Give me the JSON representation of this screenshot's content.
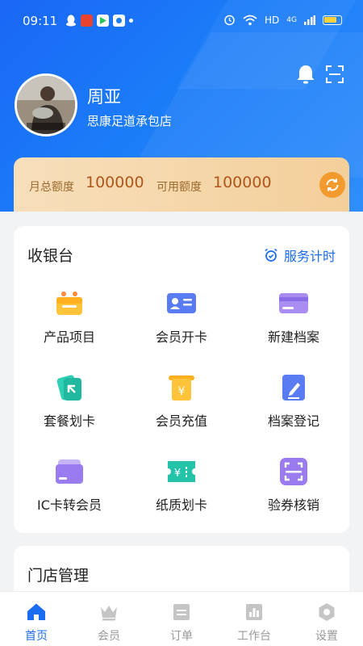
{
  "status_bar": {
    "time": "09:11",
    "network": "HD",
    "signal": "4G"
  },
  "header": {
    "user_name": "周亚",
    "store_name": "思康足道承包店",
    "notification_icon": "bell-icon",
    "scan_icon": "scan-icon"
  },
  "quota": {
    "monthly_label": "月总额度",
    "monthly_value": "100000",
    "available_label": "可用额度",
    "available_value": "100000"
  },
  "cashier": {
    "title": "收银台",
    "timer_label": "服务计时",
    "items": [
      {
        "label": "产品项目",
        "icon": "basket-icon"
      },
      {
        "label": "会员开卡",
        "icon": "id-card-icon"
      },
      {
        "label": "新建档案",
        "icon": "card-icon"
      },
      {
        "label": "套餐划卡",
        "icon": "swipe-card-icon"
      },
      {
        "label": "会员充值",
        "icon": "recharge-icon"
      },
      {
        "label": "档案登记",
        "icon": "edit-icon"
      },
      {
        "label": "IC卡转会员",
        "icon": "ic-card-icon"
      },
      {
        "label": "纸质划卡",
        "icon": "paper-card-icon"
      },
      {
        "label": "验券核销",
        "icon": "coupon-scan-icon"
      }
    ]
  },
  "store_management": {
    "title": "门店管理"
  },
  "tabbar": [
    {
      "label": "首页",
      "icon": "home-icon",
      "active": true
    },
    {
      "label": "会员",
      "icon": "crown-icon"
    },
    {
      "label": "订单",
      "icon": "order-icon"
    },
    {
      "label": "工作台",
      "icon": "workbench-icon"
    },
    {
      "label": "设置",
      "icon": "settings-icon"
    }
  ],
  "colors": {
    "primary": "#1a6cf0",
    "accent_orange": "#f29a2e",
    "quota_value": "#b0561c"
  }
}
